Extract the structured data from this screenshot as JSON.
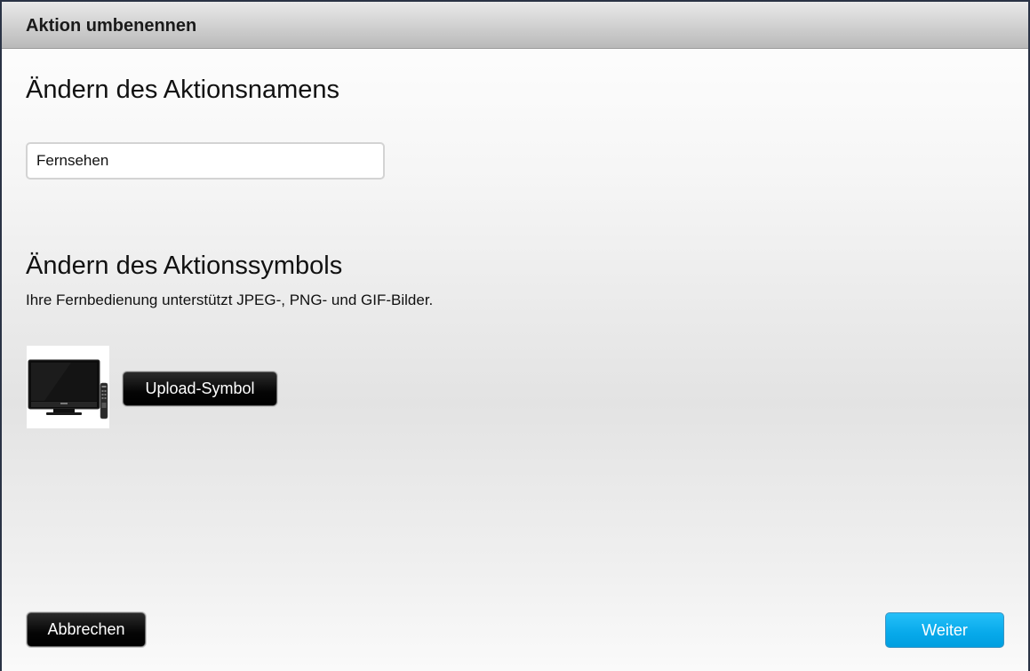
{
  "dialog": {
    "title": "Aktion umbenennen"
  },
  "name_section": {
    "heading": "Ändern des Aktionsnamens",
    "input_value": "Fernsehen"
  },
  "symbol_section": {
    "heading": "Ändern des Aktionssymbols",
    "hint": "Ihre Fernbedienung unterstützt JPEG-, PNG- und GIF-Bilder.",
    "current_icon": "tv-icon",
    "upload_label": "Upload-Symbol"
  },
  "footer": {
    "cancel_label": "Abbrechen",
    "next_label": "Weiter"
  },
  "colors": {
    "accent": "#07a9ea",
    "dark_button": "#000000",
    "frame": "#2a3345"
  }
}
